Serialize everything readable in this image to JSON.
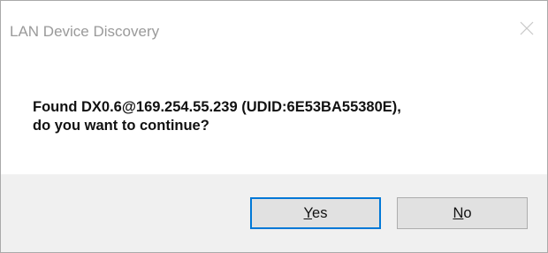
{
  "window": {
    "title": "LAN Device Discovery",
    "close_icon": "close-icon"
  },
  "message": {
    "line1": "Found DX0.6@169.254.55.239 (UDID:6E53BA55380E),",
    "line2": "do you want to continue?"
  },
  "buttons": {
    "yes": {
      "mnemonic": "Y",
      "rest": "es"
    },
    "no": {
      "mnemonic": "N",
      "rest": "o"
    }
  },
  "colors": {
    "accent_focus": "#0078d7",
    "footer_bg": "#f0f0f0",
    "button_bg": "#e1e1e1"
  }
}
